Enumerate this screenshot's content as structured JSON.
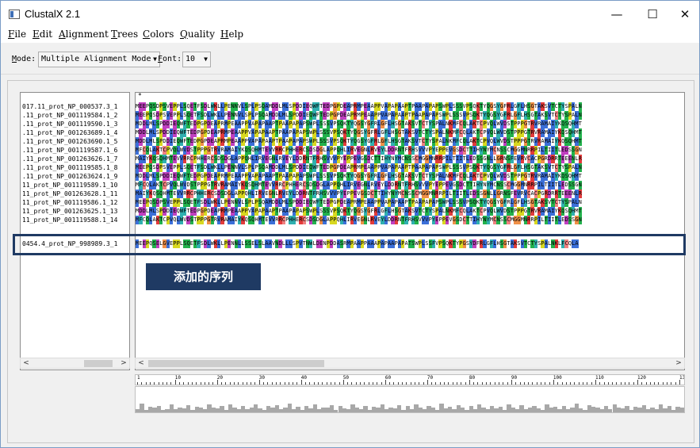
{
  "window": {
    "title": "ClustalX 2.1",
    "minimize": "—",
    "maximize": "☐",
    "close": "✕"
  },
  "menu": [
    {
      "key": "F",
      "rest": "ile"
    },
    {
      "key": "E",
      "rest": "dit"
    },
    {
      "key": "A",
      "rest": "lignment"
    },
    {
      "key": "T",
      "rest": "rees"
    },
    {
      "key": "C",
      "rest": "olors"
    },
    {
      "key": "Q",
      "rest": "uality"
    },
    {
      "key": "H",
      "rest": "elp"
    }
  ],
  "toolbar": {
    "mode_label_key": "M",
    "mode_label_rest": "ode:",
    "mode_value": "Multiple Alignment Mode",
    "font_label_key": "F",
    "font_label_rest": "ont:",
    "font_value": "10"
  },
  "consensus_marker": "*",
  "names": [
    "017.11_prot_NP_000537.3_1",
    ".11_prot_NP_001119584.1_2",
    ".11_prot_NP_001119590.1_3",
    ".11_prot_NP_001263689.1_4",
    ".11_prot_NP_001263690.1_5",
    ".11_prot_NP_001119587.1_6",
    ".11_prot_NP_001263626.1_7",
    ".11_prot_NP_001119585.1_8",
    ".11_prot_NP_001263624.1_9",
    "11_prot_NP_001119589.1_10",
    "11_prot_NP_001263628.1_11",
    "11_prot_NP_001119586.1_12",
    "11_prot_NP_001263625.1_13",
    "11_prot_NP_001119588.1_14",
    "0454.4_prot_NP_998989.3_1"
  ],
  "sequences": [
    "MEEPQSDPSVEPPLSQETFSDLWKLLPENNVLSPLPSQAMDDLMLSPDDIEQWFTEDPGPDEAPRMPEAAPPVAPAPAAPTPAAPAPAPSWPLSSSVPSQKTYQGSYGFRLGFLHSGTAKSVTCTYSPALN",
    "MEEPQSDPSVEPPLSQETFSDLWKLLPENNVLSPLPSQAMDDLMLSPDDIEQWFTEDPGPDEAPRMPEAAPPVAPAPAAPTPAAPAPAPSWPLSSSVPSQKTYQGSYGFRLGFLHSGTAKSVTCTYSPALN",
    "MDDLMLSPDDIEQWFTEDPGPDEAPRMPEAAPPVAPAPAAPTPAAPAPAPSWPLSSSVPSQKTYQGSYGFRLGFLHSGTAKSVTCTYSPALNKMFCQLAKTCPVQLWVDSTPPPGTRVRAMAIYKQSQHMT",
    "MDDLMLSPDDIEQWFTEDPGPDEAPRMPEAAPPVAPAPAAPTPAAPAPAPSWPLSSSVPSQKTYQGSYGFRLGFLHSGTAKSVTCTYSPALNKMFCQLAKTCPVQLWVDSTPPPGTRVRAMAIYKQSQHMT",
    "MDDLMLSPDDIEQWFTEDPGPDEAPRMPEAAPPVAPAPAAPTPAAPAPAPSWPLSSSVPSQKTYQGSYGFRLGFLHSGTAKSVTCTYSPALNKMFCQLAKTCPVQLWVDSTPPPGTRVRAMAIYKQSQHMT",
    "MFCQLAKTCPVQLWVDSTPPPGTRVRAMAIYKQSQHMTEVVRRCPHHERCSDSDGLAPPQHLIRVEGNLRVEYLDDRNTFRHSVVVPYEPPEVGSDCTTIHYNYMCNSSCMGGMNRRPILTIITLEDSSGN",
    "MAIYKQSQHMTEVVRRCPHHERCSDSDGLAPPQHLIRVEGNLRVEYLDDRNTFRHSVVVPYEPPEVGSDCTTIHYNYMCNSSCMGGMNRRPILTIITLEDSSGNLLGRNSFEVRVCACPGRDRRTEEENLR",
    "MEEPQSDPSVEPPLSQETFSDLWKLLPENNVLSPLPSQAMDDLMLSPDDIEQWFTEDPGPDEAPRMPEAAPPVAPAPAAPTPAAPAPAPSWPLSSSVPSQKTYQGSYGFRLGFLHSGTAKSVTCTYSPALN",
    "MDDLMLSPDDIEQWFTEDPGPDEAPRMPEAAPPVAPAPAAPTPAAPAPAPSWPLSSSVPSQKTYQGSYGFRLGFLHSGTAKSVTCTYSPALNKMFCQLAKTCPVQLWVDSTPPPGTRVRAMAIYKQSQHMT",
    "MFCQLAKTCPVQLWVDSTPPPGTRVRAMAIYKQSQHMTEVVRRCPHHERCSDSDGLAPPQHLIRVEGNLRVEYLDDRNTFRHSVVVPYEPPEVGSDCTTIHYNYMCNSSCMGGMNRRPILTIITLEDSSGN",
    "MAIYKQSQHMTEVVRRCPHHERCSDSDGLAPPQHLIRVEGNLRVEYLDDRNTFRHSVVVPYEPPEVGSDCTTIHYNYMCNSSCMGGMNRRPILTIITLEDSSGNLLGRNSFEVRVCACPGRDRRTEEENLR",
    "MEEPQSDPSVEPPLSQETFSDLWKLLPENNVLSPLPSQAMDDLMLSPDDIEQWFTEDPGPDEAPRMPEAAPPVAPAPAAPTPAAPAPAPSWPLSSSVPSQKTYQGSYGFRLGFLHSGTAKSVTCTYSPALN",
    "MDDLMLSPDDIEQWFTEDPGPDEAPRMPEAAPPVAPAPAAPTPAAPAPAPSWPLSSSVPSQKTYQGSYGFRLGFLHSGTAKSVTCTYSPALNKMFCQLAKTCPVQLWVDSTPPPGTRVRAMAIYKQSQHMT",
    "MFCQLAKTCPVQLWVDSTPPPGTRVRAMAIYKQSQHMTEVVRRCPHHERCSDSDGLAPPQHLIRVEGNLRVEYLDDRNTFRHSVVVPYEPPEVGSDCTTIHYNYMCNSSCMGGMNRRPILTIITLEDSSGN",
    "MEEPQSELGVEPPLSQETFSDLWKLLPENNLLSSELSLAAVNDLLLSPVTNWLDENPDDASRMPAAPPAAAPAPAAPAPATSWPLSSFVPSQKTYPGSYDFRLGFLHSGTAKSVTCTYSPALNKLFCQLA"
  ],
  "annotation_text": "添加的序列",
  "ruler_labels": [
    "1",
    "10",
    "20",
    "30",
    "40",
    "50",
    "60",
    "70",
    "80",
    "90",
    "100",
    "110",
    "120",
    "130"
  ],
  "quality_scores": [
    0.12,
    0.34,
    0.1,
    0.22,
    0.18,
    0.25,
    0.1,
    0.14,
    0.3,
    0.12,
    0.2,
    0.16,
    0.28,
    0.1,
    0.22,
    0.18,
    0.12,
    0.3,
    0.2,
    0.15,
    0.25,
    0.1,
    0.32,
    0.18,
    0.14,
    0.26,
    0.12,
    0.2,
    0.3,
    0.16,
    0.1,
    0.24,
    0.18,
    0.28,
    0.12,
    0.2,
    0.34,
    0.14,
    0.22,
    0.1,
    0.26,
    0.16,
    0.3,
    0.12,
    0.2,
    0.18,
    0.28,
    0.1,
    0.24,
    0.16,
    0.12,
    0.3,
    0.2,
    0.14,
    0.26,
    0.1,
    0.22,
    0.18,
    0.32,
    0.12,
    0.2,
    0.16,
    0.28,
    0.1,
    0.24,
    0.14,
    0.3,
    0.18,
    0.12,
    0.26,
    0.2,
    0.1,
    0.34,
    0.16,
    0.22,
    0.12,
    0.28,
    0.18,
    0.1,
    0.24,
    0.14,
    0.3,
    0.2,
    0.12,
    0.26,
    0.16,
    0.22,
    0.1,
    0.32,
    0.18,
    0.14,
    0.28,
    0.12,
    0.2,
    0.24,
    0.16,
    0.1,
    0.3,
    0.18,
    0.22,
    0.14,
    0.26,
    0.12,
    0.2,
    0.34,
    0.16,
    0.1,
    0.28,
    0.22,
    0.18,
    0.14,
    0.24,
    0.12,
    0.3,
    0.2,
    0.16,
    0.26,
    0.1,
    0.22,
    0.18,
    0.28,
    0.14,
    0.2,
    0.12,
    0.3,
    0.16,
    0.24,
    0.1,
    0.22,
    0.18
  ],
  "residue_colors": {
    "hydrophobic": "#3b6fd8",
    "positive": "#e33b3b",
    "negative": "#c040c0",
    "polar": "#22b14c",
    "cys": "#f08080",
    "gly": "#f09048",
    "pro": "#d8d820",
    "aromatic": "#30b0b0"
  },
  "colors": {
    "highlight_border": "#1f3a63",
    "annotation_bg": "#1f3a63"
  }
}
